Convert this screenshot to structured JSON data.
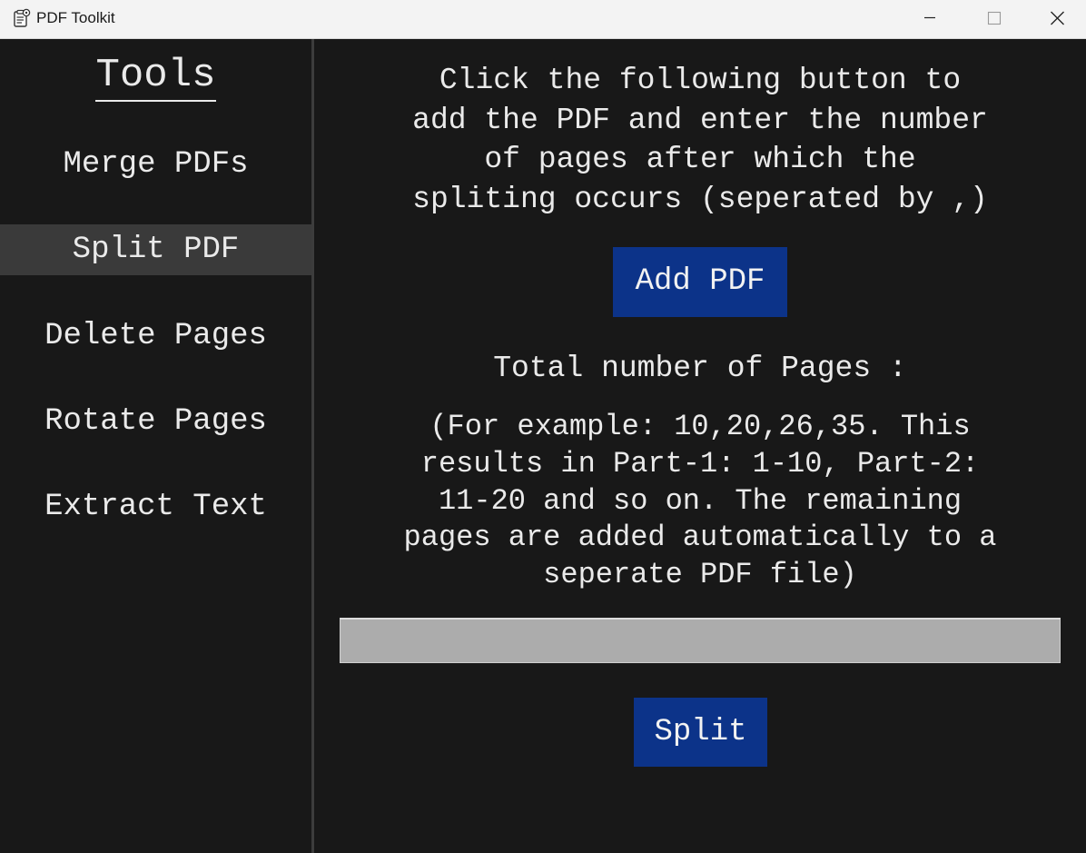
{
  "window": {
    "title": "PDF Toolkit",
    "icon": "clipboard-gear-icon",
    "controls": [
      "minimize-icon",
      "maximize-icon",
      "close-icon"
    ]
  },
  "sidebar": {
    "title": "Tools",
    "items": [
      {
        "label": "Merge PDFs",
        "active": false
      },
      {
        "label": "Split PDF",
        "active": true
      },
      {
        "label": "Delete Pages",
        "active": false
      },
      {
        "label": "Rotate Pages",
        "active": false
      },
      {
        "label": "Extract Text",
        "active": false
      }
    ]
  },
  "main": {
    "instructions": [
      "Click the following button to",
      "add the PDF and enter the number",
      "of pages after which the",
      "spliting occurs (seperated by ,)"
    ],
    "add_button_label": "Add PDF",
    "total_pages_label": "Total number of Pages :",
    "example_lines": [
      "(For example: 10,20,26,35. This",
      "results in Part-1: 1-10, Part-2:",
      "11-20 and so on. The remaining",
      "pages are added automatically to a",
      "seperate PDF file)"
    ],
    "split_input": {
      "value": "",
      "placeholder": ""
    },
    "split_button_label": "Split"
  },
  "colors": {
    "background": "#181818",
    "sidebar_active": "#3a3a3a",
    "button_blue": "#0c3389",
    "input_gray": "#acacac",
    "text": "#eaeaea"
  }
}
